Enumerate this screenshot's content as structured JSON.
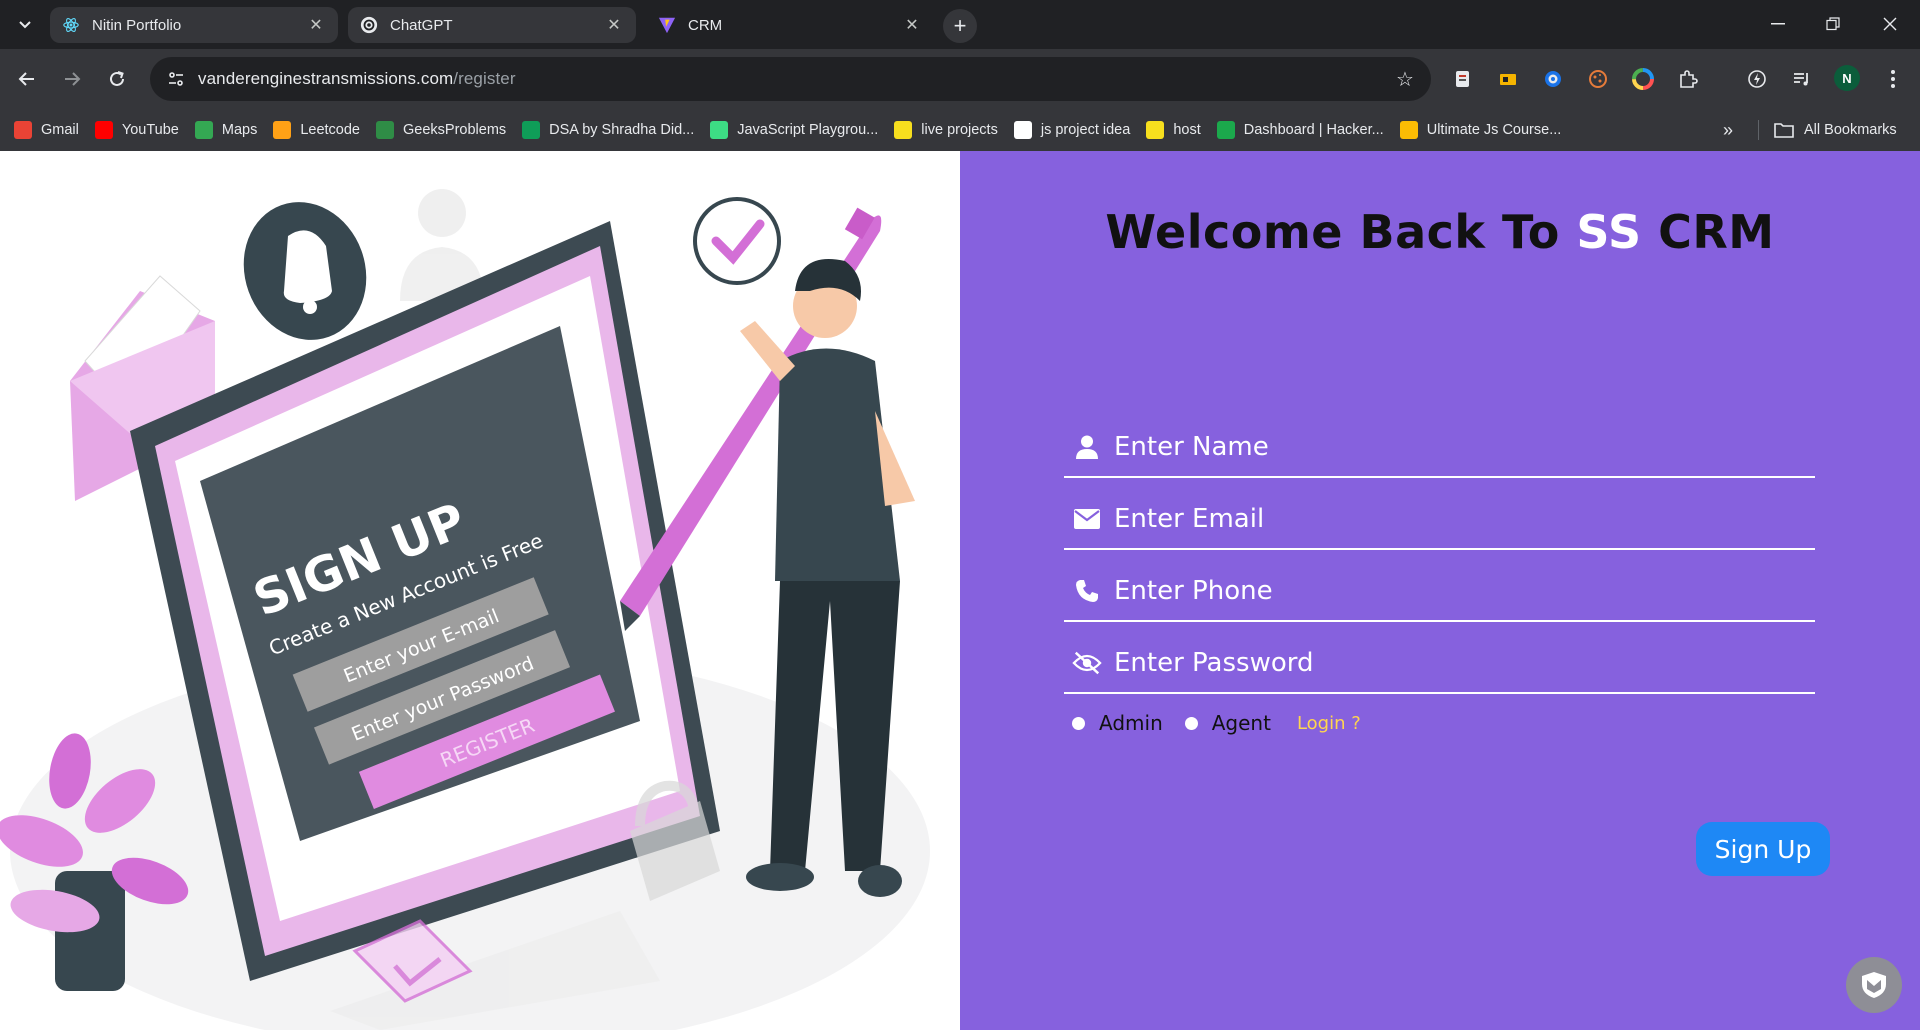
{
  "browser": {
    "tabs": [
      {
        "title": "Nitin Portfolio",
        "favicon": "react-icon",
        "active": false
      },
      {
        "title": "ChatGPT",
        "favicon": "openai-icon",
        "active": false
      },
      {
        "title": "CRM",
        "favicon": "vite-icon",
        "active": true
      }
    ],
    "url_host": "vanderenginestransmissions.com",
    "url_path": "/register",
    "bookmarks": [
      {
        "label": "Gmail",
        "icon": "gmail-icon",
        "color": "#ea4335"
      },
      {
        "label": "YouTube",
        "icon": "youtube-icon",
        "color": "#ff0000"
      },
      {
        "label": "Maps",
        "icon": "maps-icon",
        "color": "#34a853"
      },
      {
        "label": "Leetcode",
        "icon": "leetcode-icon",
        "color": "#ffa116"
      },
      {
        "label": "GeeksProblems",
        "icon": "geeksforgeeks-icon",
        "color": "#2f8d46"
      },
      {
        "label": "DSA by Shradha Did...",
        "icon": "sheets-icon",
        "color": "#0f9d58"
      },
      {
        "label": "JavaScript Playgrou...",
        "icon": "code-icon",
        "color": "#3ddc84"
      },
      {
        "label": "live projects",
        "icon": "js-icon",
        "color": "#f7df1e"
      },
      {
        "label": "js project idea",
        "icon": "lambda-icon",
        "color": "#ffffff"
      },
      {
        "label": "host",
        "icon": "host-icon",
        "color": "#f7df1e"
      },
      {
        "label": "Dashboard | Hacker...",
        "icon": "hackerrank-icon",
        "color": "#1ba94c"
      },
      {
        "label": "Ultimate Js Course...",
        "icon": "drive-icon",
        "color": "#fbbc04"
      }
    ],
    "all_bookmarks": "All Bookmarks",
    "profile_initial": "N"
  },
  "illustration": {
    "screen_title": "SIGN UP",
    "screen_subtitle": "Create a New Account is Free",
    "email_placeholder": "Enter your E-mail",
    "password_placeholder": "Enter your Password",
    "register_label": "REGISTER"
  },
  "form": {
    "title_prefix": "Welcome Back To ",
    "title_brand": "SS",
    "title_suffix": " CRM",
    "name_placeholder": "Enter Name",
    "email_placeholder": "Enter Email",
    "phone_placeholder": "Enter Phone",
    "password_placeholder": "Enter Password",
    "role_admin": "Admin",
    "role_agent": "Agent",
    "login_link": "Login ?",
    "submit_label": "Sign Up"
  },
  "colors": {
    "panel_bg": "#8661de",
    "accent_pink": "#d36fd6",
    "button_blue": "#1e88f5",
    "link_yellow": "#ffd54f"
  }
}
